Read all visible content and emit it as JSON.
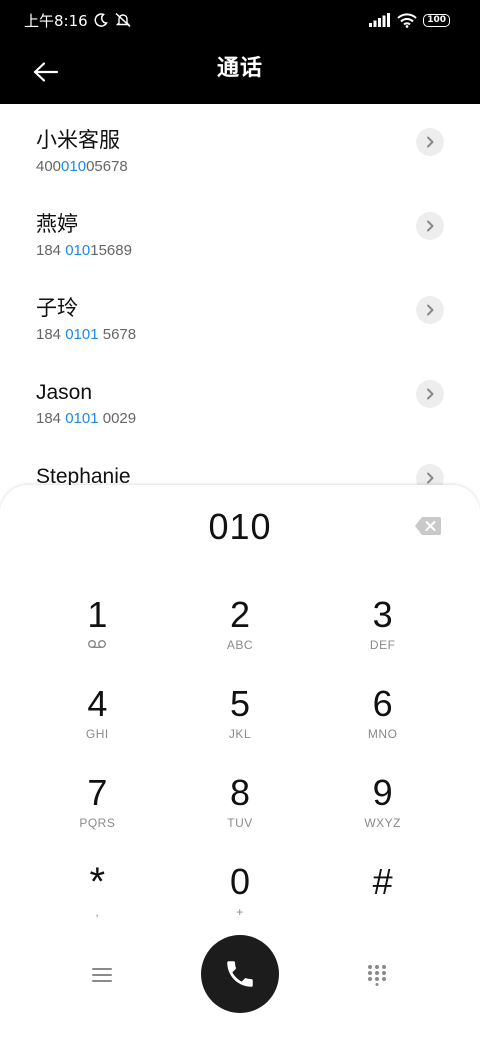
{
  "status_bar": {
    "time": "上午8:16",
    "battery": "100"
  },
  "header": {
    "title": "通话"
  },
  "contacts": [
    {
      "name": "小米客服",
      "number_parts": [
        "400",
        "010",
        "05678"
      ]
    },
    {
      "name": "燕婷",
      "number_parts": [
        "184 ",
        "010",
        "15689"
      ]
    },
    {
      "name": "子玲",
      "number_parts": [
        "184 ",
        "0101",
        " 5678"
      ]
    },
    {
      "name": "Jason",
      "number_parts": [
        "184 ",
        "0101",
        " 0029"
      ]
    },
    {
      "name": "Stephanie",
      "number_parts": [
        "",
        "",
        ""
      ]
    }
  ],
  "dialpad": {
    "dialed_number": "010",
    "keys": [
      {
        "digit": "1",
        "letters": ""
      },
      {
        "digit": "2",
        "letters": "ABC"
      },
      {
        "digit": "3",
        "letters": "DEF"
      },
      {
        "digit": "4",
        "letters": "GHI"
      },
      {
        "digit": "5",
        "letters": "JKL"
      },
      {
        "digit": "6",
        "letters": "MNO"
      },
      {
        "digit": "7",
        "letters": "PQRS"
      },
      {
        "digit": "8",
        "letters": "TUV"
      },
      {
        "digit": "9",
        "letters": "WXYZ"
      },
      {
        "digit": "*",
        "letters": ","
      },
      {
        "digit": "0",
        "letters": "+"
      },
      {
        "digit": "#",
        "letters": ""
      }
    ]
  },
  "colors": {
    "highlight": "#1e88e5",
    "header_bg": "#000000",
    "call_button_bg": "#1c1c1c"
  },
  "icons": {
    "back": "arrow-left-icon",
    "detail": "chevron-right-icon",
    "backspace": "backspace-icon",
    "voicemail": "voicemail-icon",
    "menu": "menu-icon",
    "call": "phone-icon",
    "keypad": "dialpad-icon"
  }
}
